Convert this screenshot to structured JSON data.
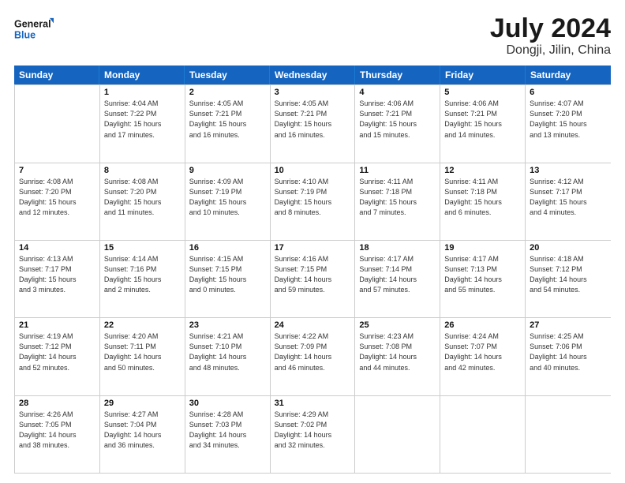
{
  "header": {
    "logo_line1": "General",
    "logo_line2": "Blue",
    "month": "July 2024",
    "location": "Dongji, Jilin, China"
  },
  "days_of_week": [
    "Sunday",
    "Monday",
    "Tuesday",
    "Wednesday",
    "Thursday",
    "Friday",
    "Saturday"
  ],
  "weeks": [
    [
      {
        "day": "",
        "info": ""
      },
      {
        "day": "1",
        "info": "Sunrise: 4:04 AM\nSunset: 7:22 PM\nDaylight: 15 hours\nand 17 minutes."
      },
      {
        "day": "2",
        "info": "Sunrise: 4:05 AM\nSunset: 7:21 PM\nDaylight: 15 hours\nand 16 minutes."
      },
      {
        "day": "3",
        "info": "Sunrise: 4:05 AM\nSunset: 7:21 PM\nDaylight: 15 hours\nand 16 minutes."
      },
      {
        "day": "4",
        "info": "Sunrise: 4:06 AM\nSunset: 7:21 PM\nDaylight: 15 hours\nand 15 minutes."
      },
      {
        "day": "5",
        "info": "Sunrise: 4:06 AM\nSunset: 7:21 PM\nDaylight: 15 hours\nand 14 minutes."
      },
      {
        "day": "6",
        "info": "Sunrise: 4:07 AM\nSunset: 7:20 PM\nDaylight: 15 hours\nand 13 minutes."
      }
    ],
    [
      {
        "day": "7",
        "info": "Sunrise: 4:08 AM\nSunset: 7:20 PM\nDaylight: 15 hours\nand 12 minutes."
      },
      {
        "day": "8",
        "info": "Sunrise: 4:08 AM\nSunset: 7:20 PM\nDaylight: 15 hours\nand 11 minutes."
      },
      {
        "day": "9",
        "info": "Sunrise: 4:09 AM\nSunset: 7:19 PM\nDaylight: 15 hours\nand 10 minutes."
      },
      {
        "day": "10",
        "info": "Sunrise: 4:10 AM\nSunset: 7:19 PM\nDaylight: 15 hours\nand 8 minutes."
      },
      {
        "day": "11",
        "info": "Sunrise: 4:11 AM\nSunset: 7:18 PM\nDaylight: 15 hours\nand 7 minutes."
      },
      {
        "day": "12",
        "info": "Sunrise: 4:11 AM\nSunset: 7:18 PM\nDaylight: 15 hours\nand 6 minutes."
      },
      {
        "day": "13",
        "info": "Sunrise: 4:12 AM\nSunset: 7:17 PM\nDaylight: 15 hours\nand 4 minutes."
      }
    ],
    [
      {
        "day": "14",
        "info": "Sunrise: 4:13 AM\nSunset: 7:17 PM\nDaylight: 15 hours\nand 3 minutes."
      },
      {
        "day": "15",
        "info": "Sunrise: 4:14 AM\nSunset: 7:16 PM\nDaylight: 15 hours\nand 2 minutes."
      },
      {
        "day": "16",
        "info": "Sunrise: 4:15 AM\nSunset: 7:15 PM\nDaylight: 15 hours\nand 0 minutes."
      },
      {
        "day": "17",
        "info": "Sunrise: 4:16 AM\nSunset: 7:15 PM\nDaylight: 14 hours\nand 59 minutes."
      },
      {
        "day": "18",
        "info": "Sunrise: 4:17 AM\nSunset: 7:14 PM\nDaylight: 14 hours\nand 57 minutes."
      },
      {
        "day": "19",
        "info": "Sunrise: 4:17 AM\nSunset: 7:13 PM\nDaylight: 14 hours\nand 55 minutes."
      },
      {
        "day": "20",
        "info": "Sunrise: 4:18 AM\nSunset: 7:12 PM\nDaylight: 14 hours\nand 54 minutes."
      }
    ],
    [
      {
        "day": "21",
        "info": "Sunrise: 4:19 AM\nSunset: 7:12 PM\nDaylight: 14 hours\nand 52 minutes."
      },
      {
        "day": "22",
        "info": "Sunrise: 4:20 AM\nSunset: 7:11 PM\nDaylight: 14 hours\nand 50 minutes."
      },
      {
        "day": "23",
        "info": "Sunrise: 4:21 AM\nSunset: 7:10 PM\nDaylight: 14 hours\nand 48 minutes."
      },
      {
        "day": "24",
        "info": "Sunrise: 4:22 AM\nSunset: 7:09 PM\nDaylight: 14 hours\nand 46 minutes."
      },
      {
        "day": "25",
        "info": "Sunrise: 4:23 AM\nSunset: 7:08 PM\nDaylight: 14 hours\nand 44 minutes."
      },
      {
        "day": "26",
        "info": "Sunrise: 4:24 AM\nSunset: 7:07 PM\nDaylight: 14 hours\nand 42 minutes."
      },
      {
        "day": "27",
        "info": "Sunrise: 4:25 AM\nSunset: 7:06 PM\nDaylight: 14 hours\nand 40 minutes."
      }
    ],
    [
      {
        "day": "28",
        "info": "Sunrise: 4:26 AM\nSunset: 7:05 PM\nDaylight: 14 hours\nand 38 minutes."
      },
      {
        "day": "29",
        "info": "Sunrise: 4:27 AM\nSunset: 7:04 PM\nDaylight: 14 hours\nand 36 minutes."
      },
      {
        "day": "30",
        "info": "Sunrise: 4:28 AM\nSunset: 7:03 PM\nDaylight: 14 hours\nand 34 minutes."
      },
      {
        "day": "31",
        "info": "Sunrise: 4:29 AM\nSunset: 7:02 PM\nDaylight: 14 hours\nand 32 minutes."
      },
      {
        "day": "",
        "info": ""
      },
      {
        "day": "",
        "info": ""
      },
      {
        "day": "",
        "info": ""
      }
    ]
  ]
}
